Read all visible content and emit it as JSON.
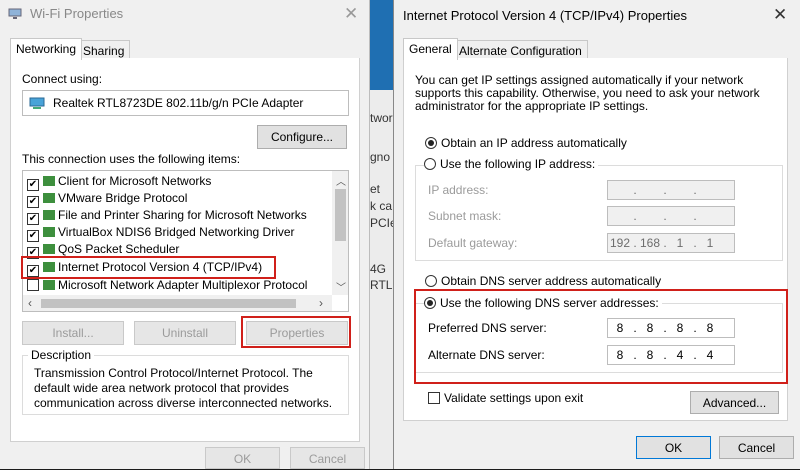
{
  "background": {
    "fragments": [
      "twor",
      "gno",
      "et",
      "k ca",
      "PCIe",
      "4G",
      "RTL"
    ]
  },
  "left_dialog": {
    "title": "Wi-Fi Properties",
    "tabs": [
      "Networking",
      "Sharing"
    ],
    "connect_using_label": "Connect using:",
    "adapter": "Realtek RTL8723DE 802.11b/g/n PCIe Adapter",
    "configure_button": "Configure...",
    "items_label": "This connection uses the following items:",
    "items": [
      {
        "label": "Client for Microsoft Networks",
        "checked": true
      },
      {
        "label": "VMware Bridge Protocol",
        "checked": true
      },
      {
        "label": "File and Printer Sharing for Microsoft Networks",
        "checked": true
      },
      {
        "label": "VirtualBox NDIS6 Bridged Networking Driver",
        "checked": true
      },
      {
        "label": "QoS Packet Scheduler",
        "checked": true
      },
      {
        "label": "Internet Protocol Version 4 (TCP/IPv4)",
        "checked": true
      },
      {
        "label": "Microsoft Network Adapter Multiplexor Protocol",
        "checked": false
      }
    ],
    "install_button": "Install...",
    "uninstall_button": "Uninstall",
    "properties_button": "Properties",
    "description_label": "Description",
    "description_text": "Transmission Control Protocol/Internet Protocol. The default wide area network protocol that provides communication across diverse interconnected networks.",
    "ok_button": "OK",
    "cancel_button": "Cancel"
  },
  "right_dialog": {
    "title": "Internet Protocol Version 4 (TCP/IPv4) Properties",
    "tabs": [
      "General",
      "Alternate Configuration"
    ],
    "intro_text": "You can get IP settings assigned automatically if your network supports this capability. Otherwise, you need to ask your network administrator for the appropriate IP settings.",
    "obtain_ip_auto": "Obtain an IP address automatically",
    "use_following_ip": "Use the following IP address:",
    "ip_address_label": "IP address:",
    "subnet_mask_label": "Subnet mask:",
    "default_gateway_label": "Default gateway:",
    "ip_address_value": [
      "",
      "",
      "",
      ""
    ],
    "subnet_mask_value": [
      "",
      "",
      "",
      ""
    ],
    "default_gateway_value": [
      "192",
      "168",
      "1",
      "1"
    ],
    "obtain_dns_auto": "Obtain DNS server address automatically",
    "use_following_dns": "Use the following DNS server addresses:",
    "preferred_dns_label": "Preferred DNS server:",
    "alternate_dns_label": "Alternate DNS server:",
    "preferred_dns_value": [
      "8",
      "8",
      "8",
      "8"
    ],
    "alternate_dns_value": [
      "8",
      "8",
      "4",
      "4"
    ],
    "validate_label": "Validate settings upon exit",
    "advanced_button": "Advanced...",
    "ok_button": "OK",
    "cancel_button": "Cancel"
  },
  "colors": {
    "highlight_red": "#d0201a",
    "dialog_bg": "#f0f0f0"
  }
}
